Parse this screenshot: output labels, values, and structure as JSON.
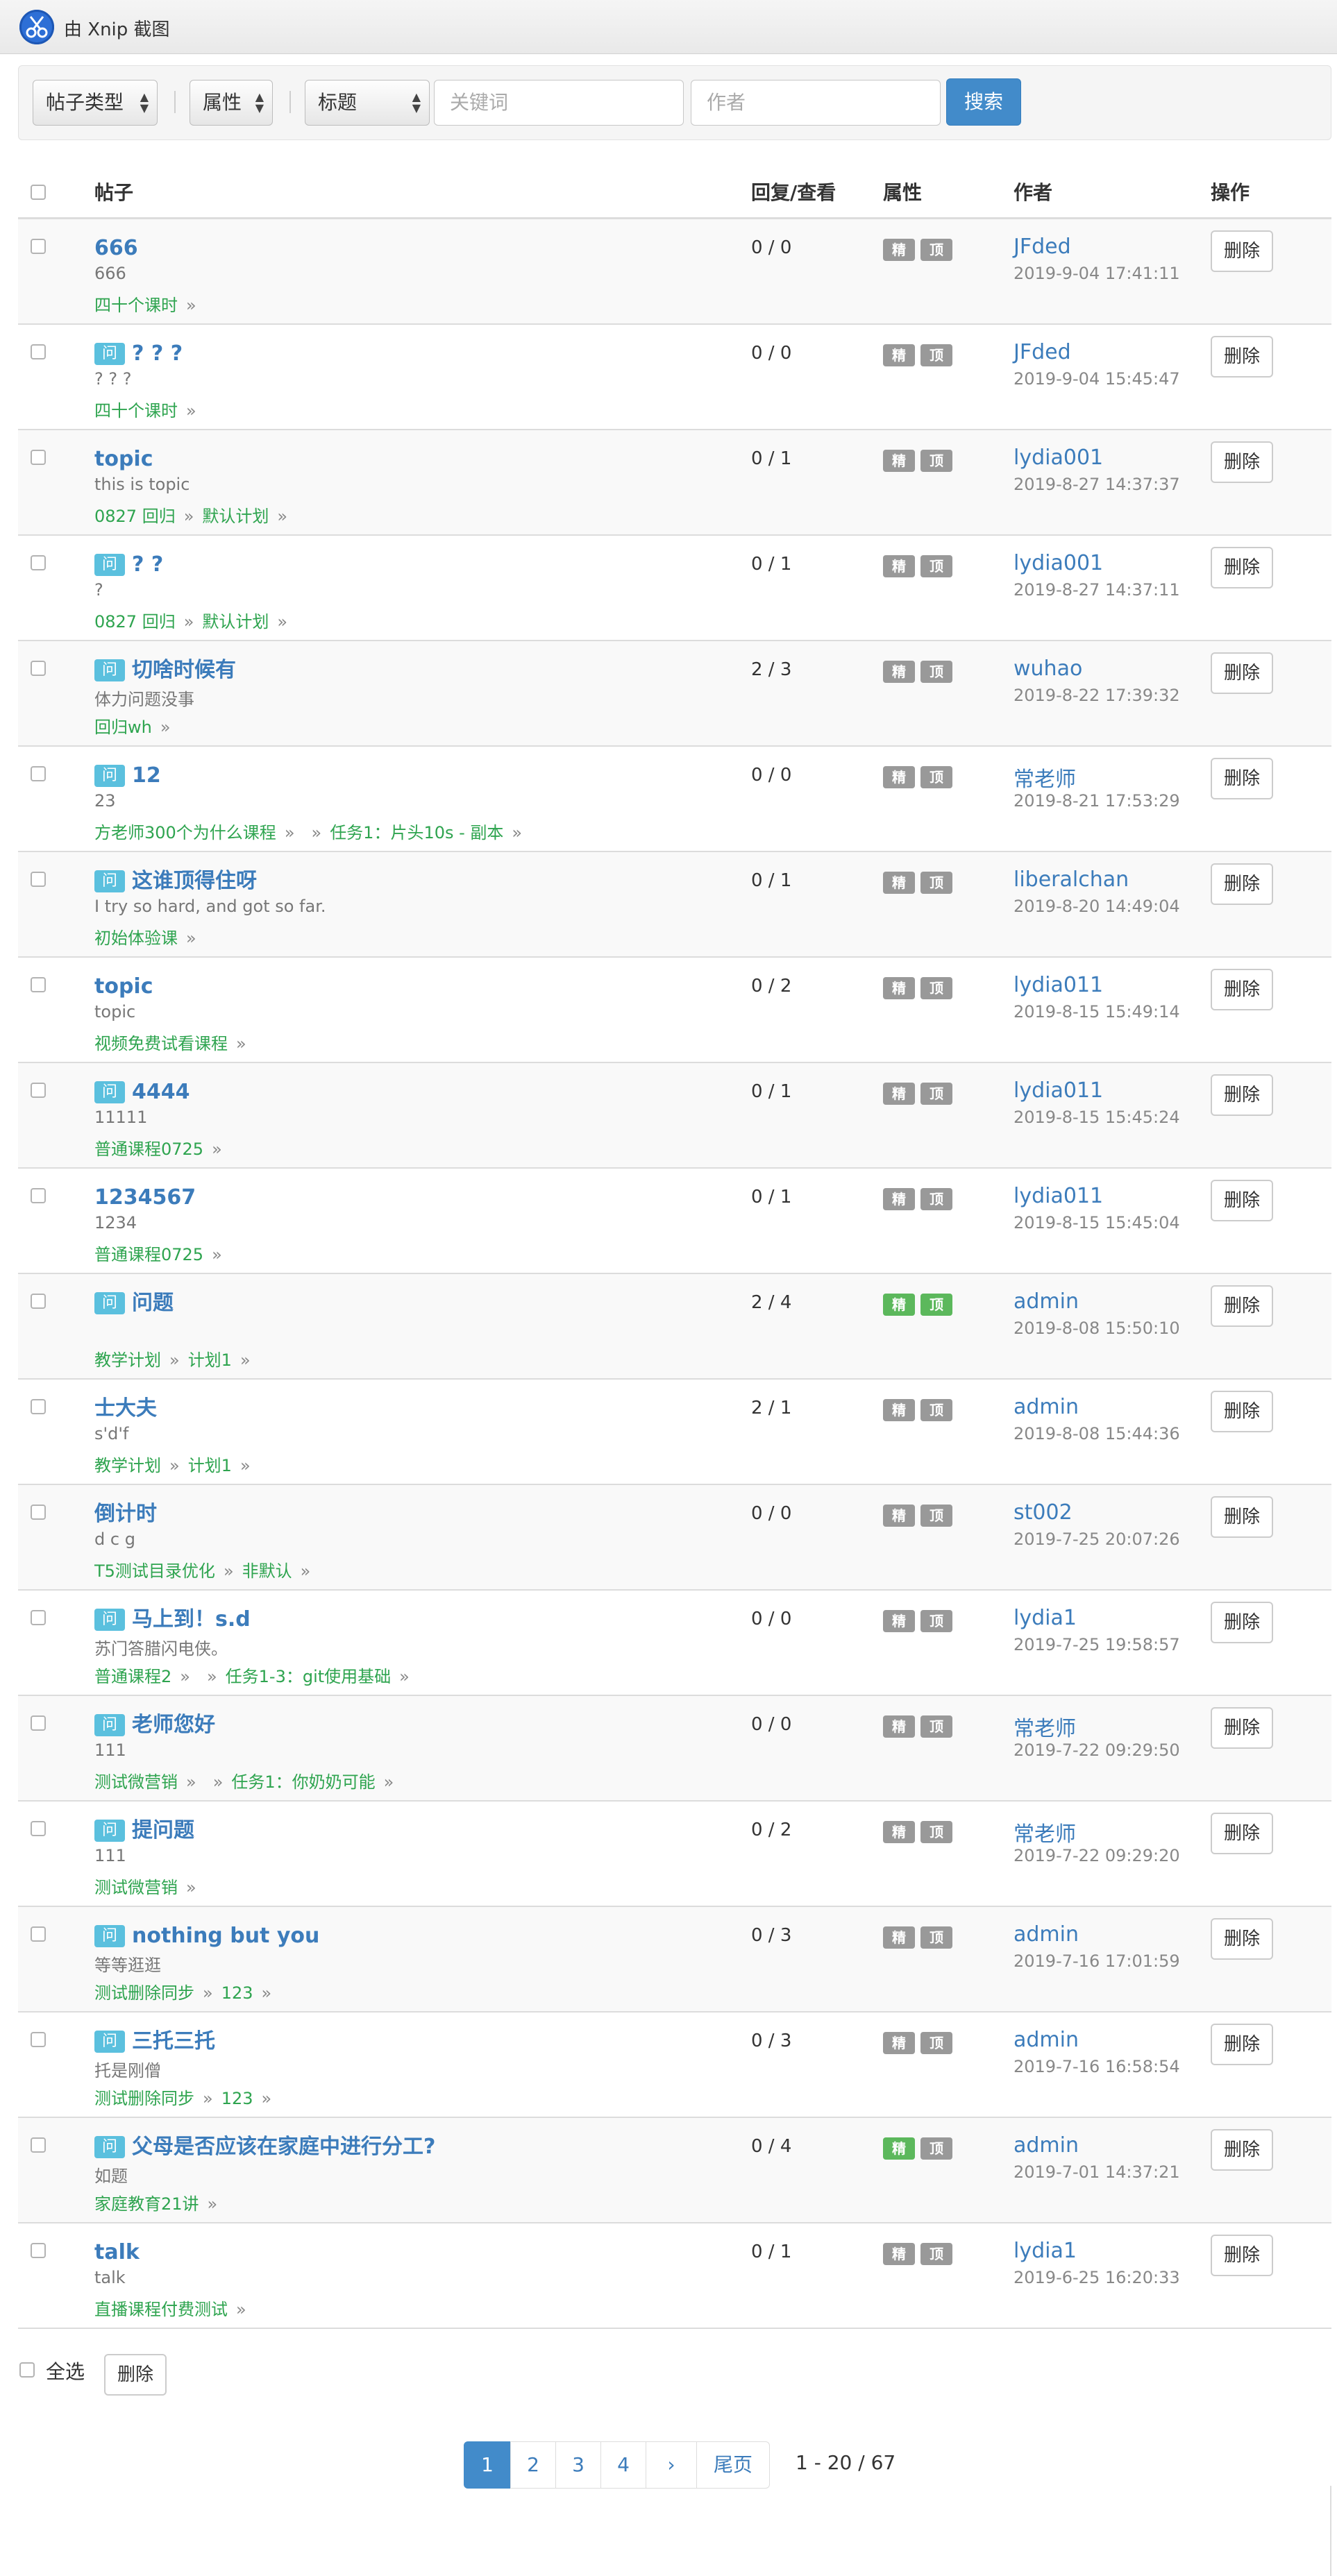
{
  "window": {
    "title": "由 Xnip 截图",
    "app_icon": "xnip-scissors-icon"
  },
  "filters": {
    "post_type": "帖子类型",
    "attribute": "属性",
    "field": "标题",
    "keyword_placeholder": "关键词",
    "author_placeholder": "作者",
    "search_label": "搜索"
  },
  "table": {
    "headers": {
      "post": "帖子",
      "replies_views": "回复/查看",
      "attributes": "属性",
      "author": "作者",
      "actions": "操作"
    },
    "question_badge": "问",
    "attr_jing": "精",
    "attr_ding": "顶",
    "delete_label": "删除",
    "tag_separator": "»",
    "colors": {
      "badge": "#5bc0de",
      "attr_off": "#999999",
      "attr_on": "#5cb85c",
      "link": "#3c7cbb",
      "tag": "#2ea44f"
    },
    "rows": [
      {
        "question": false,
        "title": "666",
        "desc": "666",
        "tags": [
          "四十个课时"
        ],
        "stats": "0 / 0",
        "jing": false,
        "ding": false,
        "author": "JFded",
        "time": "2019-9-04 17:41:11"
      },
      {
        "question": true,
        "title": "? ? ?",
        "desc": "? ? ?",
        "tags": [
          "四十个课时"
        ],
        "stats": "0 / 0",
        "jing": false,
        "ding": false,
        "author": "JFded",
        "time": "2019-9-04 15:45:47"
      },
      {
        "question": false,
        "title": "topic",
        "desc": "this  is  topic",
        "tags": [
          "0827 回归",
          "默认计划"
        ],
        "stats": "0 / 1",
        "jing": false,
        "ding": false,
        "author": "lydia001",
        "time": "2019-8-27 14:37:37"
      },
      {
        "question": true,
        "title": "? ?",
        "desc": "?",
        "tags": [
          "0827 回归",
          "默认计划"
        ],
        "stats": "0 / 1",
        "jing": false,
        "ding": false,
        "author": "lydia001",
        "time": "2019-8-27 14:37:11"
      },
      {
        "question": true,
        "title": "切啥时候有",
        "desc": "体力问题没事",
        "tags": [
          "回归wh"
        ],
        "stats": "2 / 3",
        "jing": false,
        "ding": false,
        "author": "wuhao",
        "time": "2019-8-22 17:39:32"
      },
      {
        "question": true,
        "title": "12",
        "desc": "23",
        "tags": [
          "方老师300个为什么课程",
          "",
          "任务1：片头10s - 副本"
        ],
        "stats": "0 / 0",
        "jing": false,
        "ding": false,
        "author": "常老师",
        "time": "2019-8-21 17:53:29"
      },
      {
        "question": true,
        "title": "这谁顶得住呀",
        "desc": "I try so hard, and got so far.",
        "tags": [
          "初始体验课"
        ],
        "stats": "0 / 1",
        "jing": false,
        "ding": false,
        "author": "liberalchan",
        "time": "2019-8-20 14:49:04"
      },
      {
        "question": false,
        "title": "topic",
        "desc": "topic",
        "tags": [
          "视频免费试看课程"
        ],
        "stats": "0 / 2",
        "jing": false,
        "ding": false,
        "author": "lydia011",
        "time": "2019-8-15 15:49:14"
      },
      {
        "question": true,
        "title": "4444",
        "desc": "11111",
        "tags": [
          "普通课程0725"
        ],
        "stats": "0 / 1",
        "jing": false,
        "ding": false,
        "author": "lydia011",
        "time": "2019-8-15 15:45:24"
      },
      {
        "question": false,
        "title": "1234567",
        "desc": "1234",
        "tags": [
          "普通课程0725"
        ],
        "stats": "0 / 1",
        "jing": false,
        "ding": false,
        "author": "lydia011",
        "time": "2019-8-15 15:45:04"
      },
      {
        "question": true,
        "title": "问题",
        "desc": "",
        "tags": [
          "教学计划",
          "计划1"
        ],
        "stats": "2 / 4",
        "jing": true,
        "ding": true,
        "author": "admin",
        "time": "2019-8-08 15:50:10"
      },
      {
        "question": false,
        "title": "士大夫",
        "desc": "s'd'f",
        "tags": [
          "教学计划",
          "计划1"
        ],
        "stats": "2 / 1",
        "jing": false,
        "ding": false,
        "author": "admin",
        "time": "2019-8-08 15:44:36"
      },
      {
        "question": false,
        "title": "倒计时",
        "desc": "d c g",
        "tags": [
          "T5测试目录优化",
          "非默认"
        ],
        "stats": "0 / 0",
        "jing": false,
        "ding": false,
        "author": "st002",
        "time": "2019-7-25 20:07:26"
      },
      {
        "question": true,
        "title": "马上到！s.d",
        "desc": " 苏门答腊闪电侠。",
        "tags": [
          "普通课程2",
          "",
          "任务1-3：git使用基础"
        ],
        "stats": "0 / 0",
        "jing": false,
        "ding": false,
        "author": "lydia1",
        "time": "2019-7-25 19:58:57"
      },
      {
        "question": true,
        "title": "老师您好",
        "desc": "111",
        "tags": [
          "测试微营销",
          "",
          "任务1：你奶奶可能"
        ],
        "stats": "0 / 0",
        "jing": false,
        "ding": false,
        "author": "常老师",
        "time": "2019-7-22 09:29:50"
      },
      {
        "question": true,
        "title": "提问题",
        "desc": "111",
        "tags": [
          "测试微营销"
        ],
        "stats": "0 / 2",
        "jing": false,
        "ding": false,
        "author": "常老师",
        "time": "2019-7-22 09:29:20"
      },
      {
        "question": true,
        "title": "nothing but you",
        "desc": "等等逛逛",
        "tags": [
          "测试删除同步",
          "123"
        ],
        "stats": "0 / 3",
        "jing": false,
        "ding": false,
        "author": "admin",
        "time": "2019-7-16 17:01:59"
      },
      {
        "question": true,
        "title": "三托三托",
        "desc": "托是刚僧",
        "tags": [
          "测试删除同步",
          "123"
        ],
        "stats": "0 / 3",
        "jing": false,
        "ding": false,
        "author": "admin",
        "time": "2019-7-16 16:58:54"
      },
      {
        "question": true,
        "title": "父母是否应该在家庭中进行分工?",
        "desc": "如题",
        "tags": [
          "家庭教育21讲"
        ],
        "stats": "0 / 4",
        "jing": true,
        "ding": false,
        "author": "admin",
        "time": "2019-7-01 14:37:21"
      },
      {
        "question": false,
        "title": "talk",
        "desc": "talk",
        "tags": [
          "直播课程付费测试"
        ],
        "stats": "0 / 1",
        "jing": false,
        "ding": false,
        "author": "lydia1",
        "time": "2019-6-25 16:20:33"
      }
    ]
  },
  "footer": {
    "select_all_label": "全选",
    "delete_label": "删除"
  },
  "pagination": {
    "pages": [
      "1",
      "2",
      "3",
      "4",
      "›",
      "尾页"
    ],
    "active": "1",
    "info": "1 - 20 / 67"
  }
}
